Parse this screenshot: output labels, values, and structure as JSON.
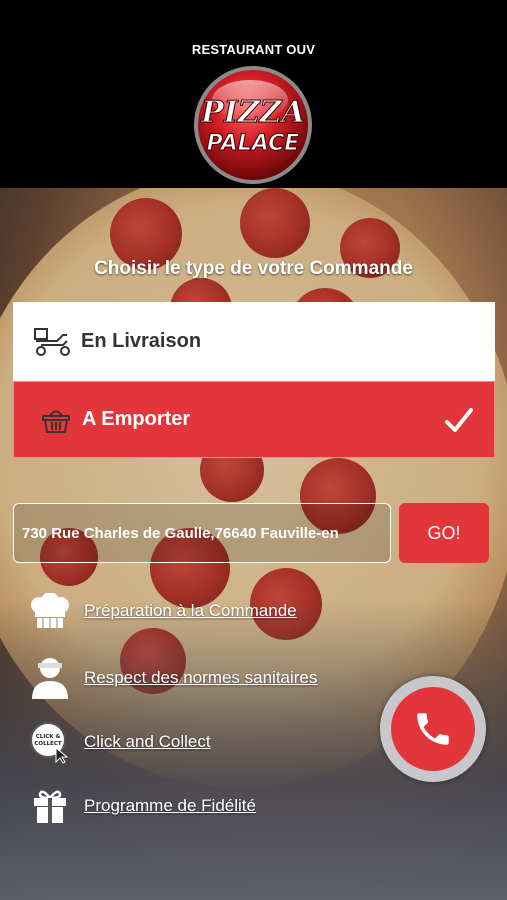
{
  "header": {
    "status_text": "RESTAURANT OUV",
    "logo_top": "PIZZA",
    "logo_bottom": "PALACE"
  },
  "main": {
    "title": "Choisir le type de votre Commande",
    "options": [
      {
        "label": "En Livraison",
        "icon": "delivery-scooter-icon",
        "selected": false
      },
      {
        "label": "A Emporter",
        "icon": "basket-icon",
        "selected": true
      }
    ],
    "address": {
      "value": "730 Rue Charles de Gaulle,76640 Fauville-en"
    },
    "go_label": "GO!",
    "links": [
      {
        "label": "Préparation à la Commande",
        "icon": "chef-hat-icon"
      },
      {
        "label": "Respect des normes sanitaires",
        "icon": "person-icon"
      },
      {
        "label": "Click and Collect",
        "icon": "click-collect-icon",
        "icon_text": "CLICK & COLLECT"
      },
      {
        "label": "Programme de Fidélité",
        "icon": "gift-icon"
      }
    ]
  },
  "colors": {
    "accent": "#e2363a",
    "header_bg": "#000000"
  },
  "call_button": {
    "icon": "phone-icon"
  }
}
